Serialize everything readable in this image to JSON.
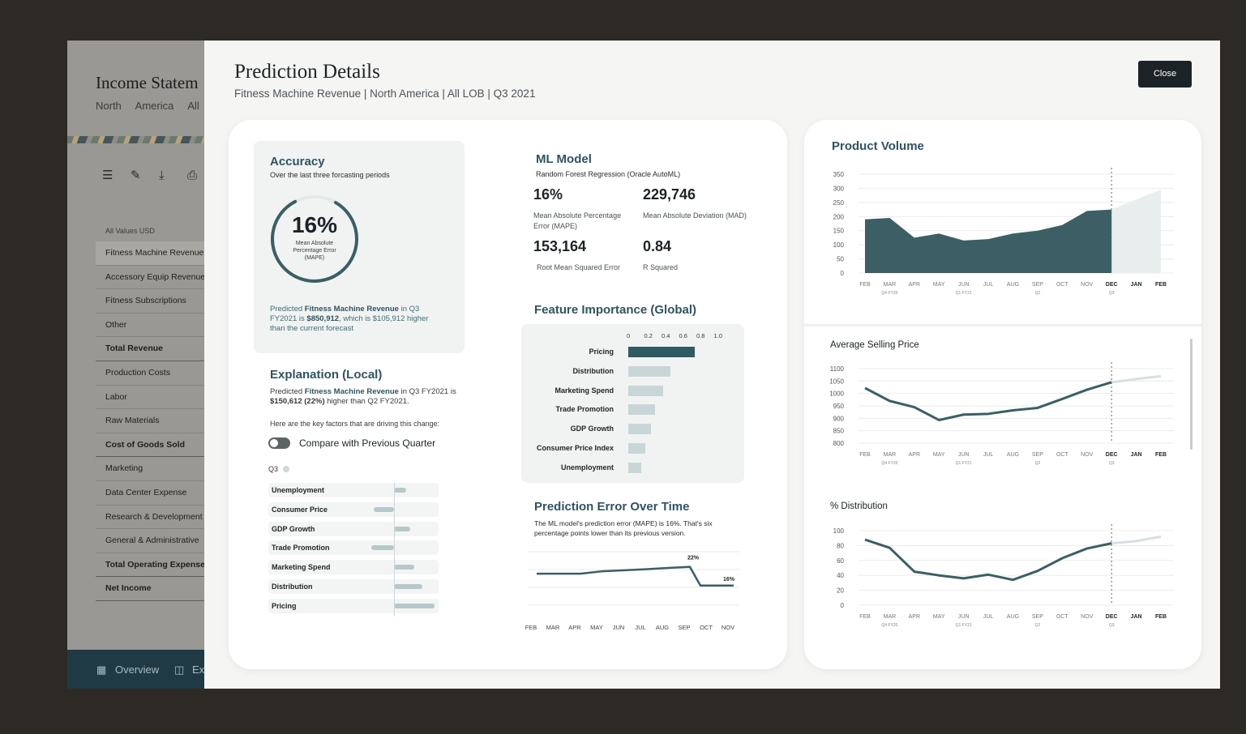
{
  "bg_app": {
    "title": "Income Statem",
    "subtitle": "North America   All L",
    "values_label": "All Values USD",
    "rows": [
      {
        "label": "Fitness Machine Revenue",
        "bold": false,
        "selected": true
      },
      {
        "label": "Accessory Equip Revenue",
        "bold": false
      },
      {
        "label": "Fitness Subscriptions",
        "bold": false
      },
      {
        "label": "Other",
        "bold": false
      },
      {
        "label": "Total Revenue",
        "bold": true
      },
      {
        "label": "Production Costs",
        "bold": false
      },
      {
        "label": "Labor",
        "bold": false
      },
      {
        "label": "Raw Materials",
        "bold": false
      },
      {
        "label": "Cost of Goods Sold",
        "bold": true
      },
      {
        "label": "Marketing",
        "bold": false
      },
      {
        "label": "Data Center Expense",
        "bold": false
      },
      {
        "label": "Research & Development",
        "bold": false
      },
      {
        "label": "General & Administrative",
        "bold": false
      },
      {
        "label": "Total Operating Expense",
        "bold": true
      },
      {
        "label": "Net Income",
        "bold": true
      }
    ],
    "footer_overview": "Overview",
    "footer_ex": "Ex"
  },
  "modal": {
    "title": "Prediction Details",
    "subtitle": "Fitness Machine Revenue | North America | All LOB | Q3 2021",
    "close_label": "Close"
  },
  "accuracy": {
    "title": "Accuracy",
    "subtitle": "Over the last three forcasting periods",
    "value": "16%",
    "value_caption": "Mean Absolute Percentage Error (MAPE)",
    "ring_fraction": 0.84,
    "note_pre": "Predicted ",
    "note_metric": "Fitness Machine Revenue",
    "note_mid": " in Q3 FY2021 is ",
    "note_amount": "$850,912",
    "note_post": ", which is $105,912 higher than the current forecast"
  },
  "explanation": {
    "title": "Explanation (Local)",
    "line_pre": "Predicted ",
    "line_metric": "Fitness Machine Revenue",
    "line_mid": " in Q3 FY2021 is ",
    "line_amount": "$150,612 (22%)",
    "line_post": " higher than Q2 FY2021.",
    "factors_text": "Here are the key factors that are driving this change:",
    "toggle_label": "Compare with Previous Quarter",
    "quarter": "Q3",
    "factors": [
      {
        "label": "Unemployment",
        "value": 0.15
      },
      {
        "label": "Consumer Price",
        "value": -0.25
      },
      {
        "label": "GDP Growth",
        "value": 0.2
      },
      {
        "label": "Trade Promotion",
        "value": -0.28
      },
      {
        "label": "Marketing Spend",
        "value": 0.25
      },
      {
        "label": "Distribution",
        "value": 0.35
      },
      {
        "label": "Pricing",
        "value": 0.5
      }
    ]
  },
  "ml_model": {
    "title": "ML Model",
    "subtitle": "Random Forest Regression (Oracle AutoML)",
    "metrics": [
      {
        "value": "16%",
        "caption": "Mean Absolute Percentage Error (MAPE)"
      },
      {
        "value": "229,746",
        "caption": "Mean Absolute Deviation (MAD)"
      },
      {
        "value": "153,164",
        "caption": "Root Mean Squared Error"
      },
      {
        "value": "0.84",
        "caption": "R Squared"
      }
    ]
  },
  "feature_importance": {
    "title": "Feature Importance (Global)",
    "ticks": [
      "0",
      "0.2",
      "0.4",
      "0.6",
      "0.8",
      "1.0"
    ],
    "features": [
      {
        "label": "Pricing",
        "value": 0.76
      },
      {
        "label": "Distribution",
        "value": 0.48
      },
      {
        "label": "Marketing Spend",
        "value": 0.4
      },
      {
        "label": "Trade Promotion",
        "value": 0.31
      },
      {
        "label": "GDP Growth",
        "value": 0.26
      },
      {
        "label": "Consumer Price Index",
        "value": 0.19
      },
      {
        "label": "Unemployment",
        "value": 0.15
      }
    ],
    "accent": "#2f5a62"
  },
  "prediction_error": {
    "title": "Prediction Error Over Time",
    "text": "The ML model's prediction error (MAPE) is 16%. That's six percentage points lower than its previous version.",
    "peak_label": "22%",
    "end_label": "16%"
  },
  "right_panel": {
    "product_volume_title": "Product Volume",
    "asp_title": "Average Selling Price",
    "dist_title": "% Distribution"
  },
  "chart_data": [
    {
      "type": "area",
      "title": "Product Volume",
      "x": [
        "FEB",
        "MAR",
        "APR",
        "MAY",
        "JUN",
        "JUL",
        "AUG",
        "SEP",
        "OCT",
        "NOV",
        "DEC",
        "JAN",
        "FEB"
      ],
      "quarter_labels": {
        "MAR": "Q4 FY20",
        "JUN": "Q1 FY21",
        "SEP": "Q2",
        "DEC": "Q3"
      },
      "yticks": [
        0,
        50,
        100,
        150,
        200,
        250,
        300,
        350
      ],
      "ylim": [
        0,
        350
      ],
      "series": [
        {
          "values": [
            190,
            195,
            125,
            140,
            115,
            120,
            140,
            150,
            170,
            220,
            225,
            null,
            null
          ]
        },
        {
          "values": [
            null,
            null,
            null,
            null,
            null,
            null,
            null,
            null,
            null,
            null,
            225,
            260,
            295
          ]
        }
      ],
      "forecast_start": "DEC"
    },
    {
      "type": "line",
      "title": "Average Selling Price",
      "x": [
        "FEB",
        "MAR",
        "APR",
        "MAY",
        "JUN",
        "JUL",
        "AUG",
        "SEP",
        "OCT",
        "NOV",
        "DEC",
        "JAN",
        "FEB"
      ],
      "quarter_labels": {
        "MAR": "Q4 FY20",
        "JUN": "Q1 FY21",
        "SEP": "Q2",
        "DEC": "Q3"
      },
      "yticks": [
        800,
        850,
        900,
        950,
        1000,
        1050,
        1100
      ],
      "ylim": [
        800,
        1100
      ],
      "series": [
        {
          "values": [
            1022,
            970,
            945,
            893,
            915,
            918,
            932,
            942,
            978,
            1015,
            1045,
            null,
            null
          ]
        },
        {
          "values": [
            null,
            null,
            null,
            null,
            null,
            null,
            null,
            null,
            null,
            null,
            1045,
            1058,
            1070
          ]
        }
      ],
      "forecast_start": "DEC"
    },
    {
      "type": "line",
      "title": "% Distribution",
      "x": [
        "FEB",
        "MAR",
        "APR",
        "MAY",
        "JUN",
        "JUL",
        "AUG",
        "SEP",
        "OCT",
        "NOV",
        "DEC",
        "JAN",
        "FEB"
      ],
      "quarter_labels": {
        "MAR": "Q4 FY20",
        "JUN": "Q1 FY21",
        "SEP": "Q2",
        "DEC": "Q3"
      },
      "yticks": [
        0,
        20,
        40,
        60,
        80,
        100
      ],
      "ylim": [
        0,
        100
      ],
      "series": [
        {
          "values": [
            88,
            77,
            45,
            40,
            36,
            41,
            34,
            46,
            63,
            76,
            83,
            null,
            null
          ]
        },
        {
          "values": [
            null,
            null,
            null,
            null,
            null,
            null,
            null,
            null,
            null,
            null,
            83,
            86,
            92
          ]
        }
      ],
      "forecast_start": "DEC"
    },
    {
      "type": "line",
      "title": "Prediction Error Over Time",
      "x": [
        "FEB",
        "MAR",
        "APR",
        "MAY",
        "JUN",
        "JUL",
        "AUG",
        "SEP",
        "OCT",
        "NOV"
      ],
      "series": [
        {
          "values": [
            19.5,
            19.5,
            19.5,
            20.2,
            20.5,
            20.8,
            21.2,
            21.5,
            16.0,
            16.0
          ]
        }
      ],
      "annotations": [
        {
          "x": "SEP",
          "label": "22%"
        },
        {
          "x": "NOV",
          "label": "16%"
        }
      ]
    }
  ]
}
